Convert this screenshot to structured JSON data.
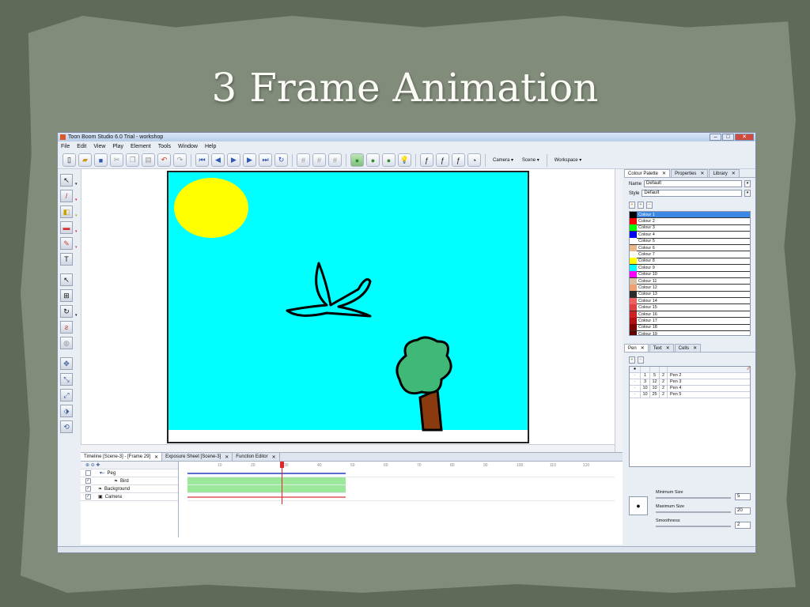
{
  "slide": {
    "title": "3 Frame Animation"
  },
  "window": {
    "title": "Toon Boom Studio 6.0 Trial - workshop",
    "min": "–",
    "max": "□",
    "close": "✕"
  },
  "menu": [
    "File",
    "Edit",
    "View",
    "Play",
    "Element",
    "Tools",
    "Window",
    "Help"
  ],
  "toolbar": {
    "camera_label": "Camera ▾",
    "scene_label": "Scene ▾",
    "workspace_label": "Workspace ▾"
  },
  "palette_panel": {
    "tabs": [
      "Colour Palette",
      "Properties",
      "Library"
    ],
    "name_label": "Name",
    "name_value": "Default",
    "style_label": "Style",
    "style_value": "Default",
    "colours": [
      {
        "name": "Colour 1",
        "hex": "#000000"
      },
      {
        "name": "Colour 2",
        "hex": "#ff0000"
      },
      {
        "name": "Colour 3",
        "hex": "#00ff00"
      },
      {
        "name": "Colour 4",
        "hex": "#0000ff"
      },
      {
        "name": "Colour 5",
        "hex": "#ffffff"
      },
      {
        "name": "Colour 6",
        "hex": "#e8b888"
      },
      {
        "name": "Colour 7",
        "hex": "#ffffff"
      },
      {
        "name": "Colour 8",
        "hex": "#ffff00"
      },
      {
        "name": "Colour 9",
        "hex": "#00ffff"
      },
      {
        "name": "Colour 10",
        "hex": "#ff00ff"
      },
      {
        "name": "Colour 11",
        "hex": "#d8c0a0"
      },
      {
        "name": "Colour 12",
        "hex": "#f0a070"
      },
      {
        "name": "Colour 13",
        "hex": "#2a2a2a"
      },
      {
        "name": "Colour 14",
        "hex": "#f06060"
      },
      {
        "name": "Colour 15",
        "hex": "#e04040"
      },
      {
        "name": "Colour 16",
        "hex": "#d02020"
      },
      {
        "name": "Colour 17",
        "hex": "#b01010"
      },
      {
        "name": "Colour 18",
        "hex": "#800000"
      },
      {
        "name": "Colour 19",
        "hex": "#600000"
      }
    ]
  },
  "pen_panel": {
    "tabs": [
      "Pen",
      "Text",
      "Cells"
    ],
    "pens": [
      {
        "min": "1",
        "max": "5",
        "smooth": "2",
        "name": "Pen 2"
      },
      {
        "min": "3",
        "max": "12",
        "smooth": "2",
        "name": "Pen 3"
      },
      {
        "min": "10",
        "max": "10",
        "smooth": "2",
        "name": "Pen 4"
      },
      {
        "min": "10",
        "max": "25",
        "smooth": "2",
        "name": "Pen 5"
      }
    ],
    "min_size_label": "Minimum Size",
    "min_size_value": "5",
    "max_size_label": "Maximum Size",
    "max_size_value": "20",
    "smoothness_label": "Smoothness",
    "smoothness_value": "2"
  },
  "timeline": {
    "tabs": [
      "Timeline [Scene-3] - [Frame 29]",
      "Exposure Sheet [Scene-3]",
      "Function Editor"
    ],
    "layers": [
      "Peg",
      "Bird",
      "Background",
      "Camera"
    ],
    "ruler": [
      "10",
      "20",
      "30",
      "40",
      "50",
      "60",
      "70",
      "80",
      "90",
      "100",
      "110",
      "120"
    ],
    "current_frame": 29
  },
  "colors": {
    "sky": "#00ffff",
    "sun": "#ffff00",
    "tree_leaves": "#40b878",
    "tree_trunk": "#8b3a10"
  }
}
